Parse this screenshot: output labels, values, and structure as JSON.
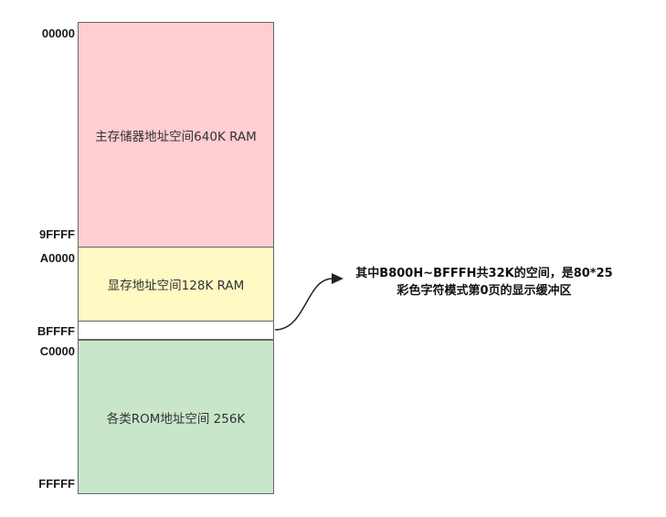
{
  "addresses": {
    "a00000": "00000",
    "a9ffff": "9FFFF",
    "aA0000": "A0000",
    "aBFFFF": "BFFFF",
    "aC0000": "C0000",
    "aFFFFF": "FFFFF"
  },
  "blocks": {
    "ram": {
      "label": "主存储器地址空间640K RAM",
      "color": "#ffcdd2"
    },
    "vram": {
      "label": "显存地址空间128K RAM",
      "color": "#fff9c4"
    },
    "buffer": {
      "label": "",
      "color": "#ffffff"
    },
    "rom": {
      "label": "各类ROM地址空间 256K",
      "color": "#c8e6c9"
    }
  },
  "annotation": {
    "line1": "其中B800H~BFFFH共32K的空间，是80*25",
    "line2": "彩色字符模式第0页的显示缓冲区"
  }
}
